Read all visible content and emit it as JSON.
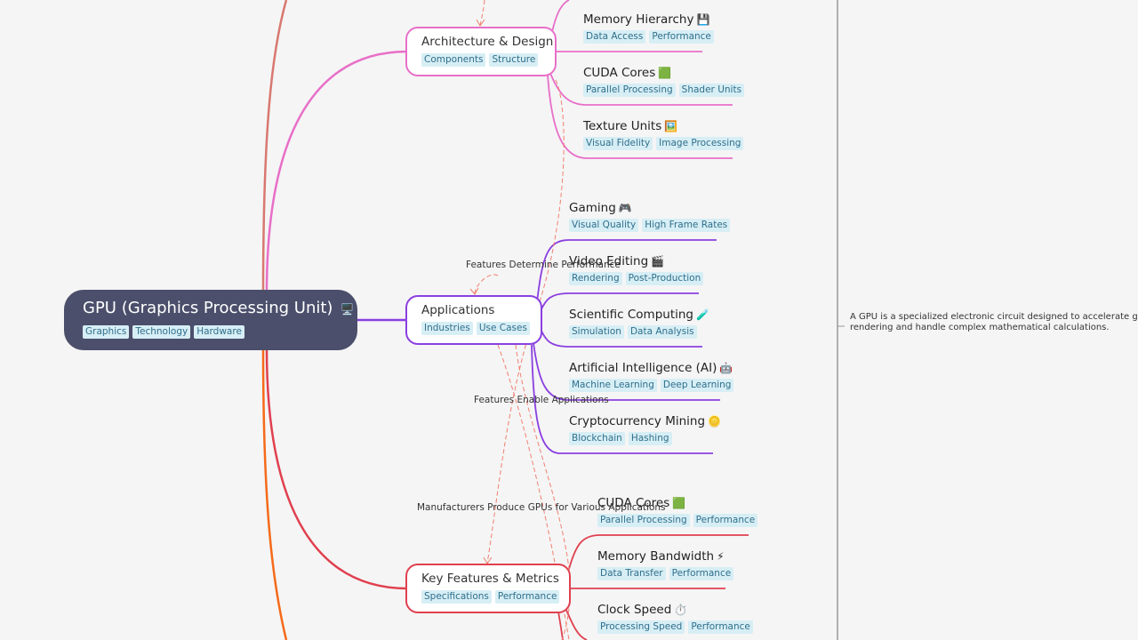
{
  "root": {
    "title": "GPU (Graphics Processing Unit)",
    "icon": "🖥️",
    "tags": [
      "Graphics",
      "Technology",
      "Hardware"
    ]
  },
  "branches": [
    {
      "title": "Architecture & Design",
      "color": "#e86fc8",
      "tags": [
        "Components",
        "Structure"
      ],
      "children": [
        {
          "title": "Memory Hierarchy",
          "icon": "💾",
          "tags": [
            "Data Access",
            "Performance"
          ]
        },
        {
          "title": "CUDA Cores",
          "icon": "🟩",
          "tags": [
            "Parallel Processing",
            "Shader Units"
          ]
        },
        {
          "title": "Texture Units",
          "icon": "🖼️",
          "tags": [
            "Visual Fidelity",
            "Image Processing"
          ]
        }
      ]
    },
    {
      "title": "Applications",
      "color": "#8a3fe0",
      "tags": [
        "Industries",
        "Use Cases"
      ],
      "children": [
        {
          "title": "Gaming",
          "icon": "🎮",
          "tags": [
            "Visual Quality",
            "High Frame Rates"
          ]
        },
        {
          "title": "Video Editing",
          "icon": "🎬",
          "tags": [
            "Rendering",
            "Post-Production"
          ]
        },
        {
          "title": "Scientific Computing",
          "icon": "🧪",
          "tags": [
            "Simulation",
            "Data Analysis"
          ]
        },
        {
          "title": "Artificial Intelligence (AI)",
          "icon": "🤖",
          "tags": [
            "Machine Learning",
            "Deep Learning"
          ]
        },
        {
          "title": "Cryptocurrency Mining",
          "icon": "🪙",
          "tags": [
            "Blockchain",
            "Hashing"
          ]
        }
      ]
    },
    {
      "title": "Key Features & Metrics",
      "color": "#e0404f",
      "tags": [
        "Specifications",
        "Performance"
      ],
      "children": [
        {
          "title": "CUDA Cores",
          "icon": "🟩",
          "tags": [
            "Parallel Processing",
            "Performance"
          ]
        },
        {
          "title": "Memory Bandwidth",
          "icon": "⚡",
          "tags": [
            "Data Transfer",
            "Performance"
          ]
        },
        {
          "title": "Clock Speed",
          "icon": "⏱️",
          "tags": [
            "Processing Speed",
            "Performance"
          ]
        }
      ]
    }
  ],
  "relationships": [
    {
      "label": "Features Determine Performance"
    },
    {
      "label": "Features Enable Applications"
    },
    {
      "label": "Manufacturers Produce GPUs for Various Applications"
    }
  ],
  "note": {
    "text": "A GPU is a specialized electronic circuit designed to accelerate g\nrendering and handle complex mathematical calculations."
  },
  "colors": {
    "root_bg": "#4b4f6b",
    "tag_bg": "#d7eef5",
    "tag_text": "#2f6f8c",
    "relation_line": "#f08070",
    "upper_branch_line": "#d87870",
    "lower_branch_line": "#f56a1a"
  }
}
